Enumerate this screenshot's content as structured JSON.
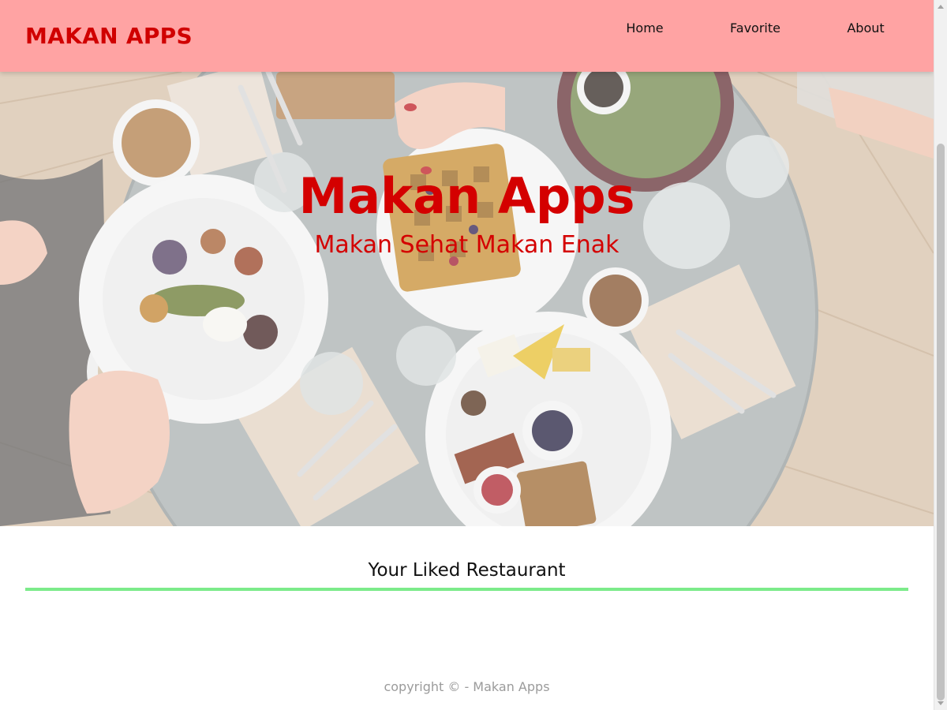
{
  "header": {
    "brand": "MAKAN APPS",
    "nav": [
      {
        "label": "Home"
      },
      {
        "label": "Favorite"
      },
      {
        "label": "About"
      }
    ]
  },
  "hero": {
    "title": "Makan Apps",
    "subtitle": "Makan Sehat Makan Enak",
    "image": "table-with-breakfast-plates-photo"
  },
  "liked_section": {
    "title": "Your Liked Restaurant",
    "items": []
  },
  "footer": {
    "text": "copyright © - Makan Apps"
  },
  "colors": {
    "app_bar": "#ffa3a3",
    "brand_red": "#d00000",
    "hero_text_red": "#d40000",
    "divider_green": "#7ceb8a",
    "footer_text": "#9b9b9b"
  }
}
